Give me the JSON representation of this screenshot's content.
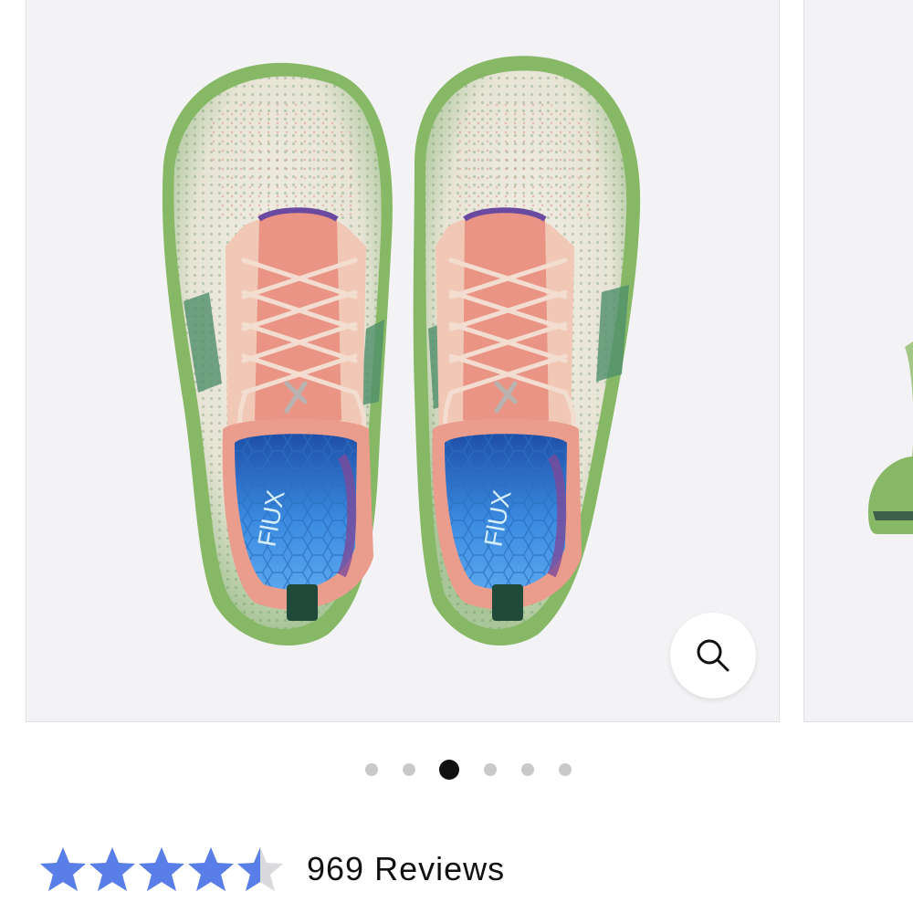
{
  "gallery": {
    "current_index": 3,
    "total_slides": 6,
    "insole_brand_text": "FlUX",
    "colors": {
      "background": "#f3f3f5",
      "upper_knit": "#ece8dc",
      "sole_green": "#8dbb6a",
      "tongue_salmon": "#e99484",
      "insole_blue": "#3f86d4"
    }
  },
  "zoom_button": {
    "icon": "magnifier-icon"
  },
  "pagination": {
    "dots": [
      {
        "active": false
      },
      {
        "active": false
      },
      {
        "active": true
      },
      {
        "active": false
      },
      {
        "active": false
      },
      {
        "active": false
      }
    ]
  },
  "rating": {
    "stars": 4.5,
    "max_stars": 5,
    "star_color": "#5a7ee8",
    "reviews_label": "969 Reviews"
  }
}
